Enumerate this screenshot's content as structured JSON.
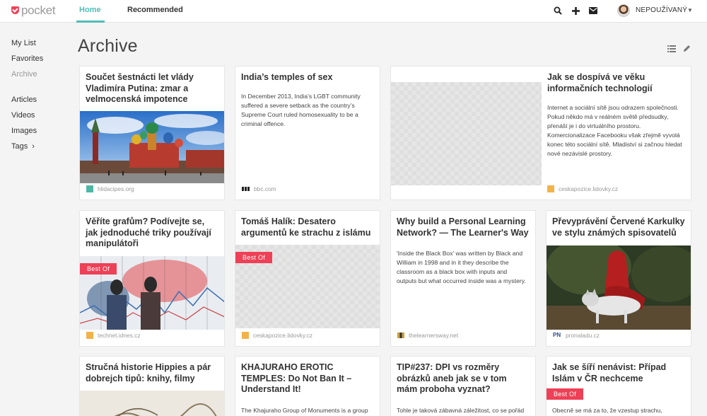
{
  "app": {
    "logo_text": "pocket"
  },
  "nav": {
    "tabs": [
      {
        "label": "Home",
        "active": true
      },
      {
        "label": "Recommended",
        "active": false
      }
    ],
    "user_name": "NEPOUŽÍVANÝ"
  },
  "sidebar": {
    "items": [
      {
        "label": "My List"
      },
      {
        "label": "Favorites"
      },
      {
        "label": "Archive",
        "active": true
      },
      {
        "label": "Articles"
      },
      {
        "label": "Videos"
      },
      {
        "label": "Images"
      },
      {
        "label": "Tags"
      }
    ]
  },
  "page": {
    "title": "Archive"
  },
  "cards": [
    {
      "title": "Součet šestnácti let vlády Vladimíra Putina: zmar a velmocenská impotence",
      "source": "hlidacipes.org"
    },
    {
      "title": "India’s temples of sex",
      "excerpt": "In December 2013, India’s LGBT community suffered a severe setback as the country’s Supreme Court ruled homosexuality to be a criminal offence.",
      "source": "bbc.com"
    },
    {
      "title": "Jak se dospívá ve věku informačních technologií",
      "excerpt": "Internet a sociální sítě jsou odrazem společnosti. Pokud někdo má v reálném světě předsudky, přenáší je i do virtuálního prostoru. Komercionalizace Facebooku však zřejmě vyvolá konec této sociální sítě. Mladiství si začnou hledat nové nezávislé prostory.",
      "source": "ceskapozice.lidovky.cz"
    },
    {
      "title": "Věříte grafům? Podívejte se, jak jednoduché triky používají manipulátoři",
      "badge": "Best Of",
      "source": "technet.idnes.cz"
    },
    {
      "title": "Tomáš Halík: Desatero argumentů ke strachu z islámu",
      "badge": "Best Of",
      "source": "ceskapozice.lidovky.cz"
    },
    {
      "title": "Why build a Personal Learning Network? — The Learner's Way",
      "excerpt": "'Inside the Black Box' was written by Black and William in 1998 and in it they describe the classroom as a black box with inputs and outputs but what occurred inside was a mystery.",
      "source": "thelearnersway.net"
    },
    {
      "title": "Převyprávění Červené Karkulky ve stylu známých spisovatelů",
      "source": "pronaladu.cz"
    },
    {
      "title": "Stručná historie Hippies a pár dobrejch tipů: knihy, filmy"
    },
    {
      "title": "KHAJURAHO EROTIC TEMPLES: Do Not Ban It – Understand It!",
      "excerpt": "The Khajuraho Group of Monuments is a group of"
    },
    {
      "title": "TIP#237: DPI vs rozměry obrázků aneb jak se v tom mám proboha vyznat?",
      "excerpt": "Tohle je taková zábavná záležitost, co se pořád a"
    },
    {
      "title": "Jak se šíří nenávist: Případ Islám v ČR nechceme",
      "badge": "Best Of",
      "excerpt": "Obecně se má za to, že vzestup strachu, odporu"
    }
  ],
  "colors": {
    "accent": "#50bcb6",
    "badge": "#ee4056"
  }
}
